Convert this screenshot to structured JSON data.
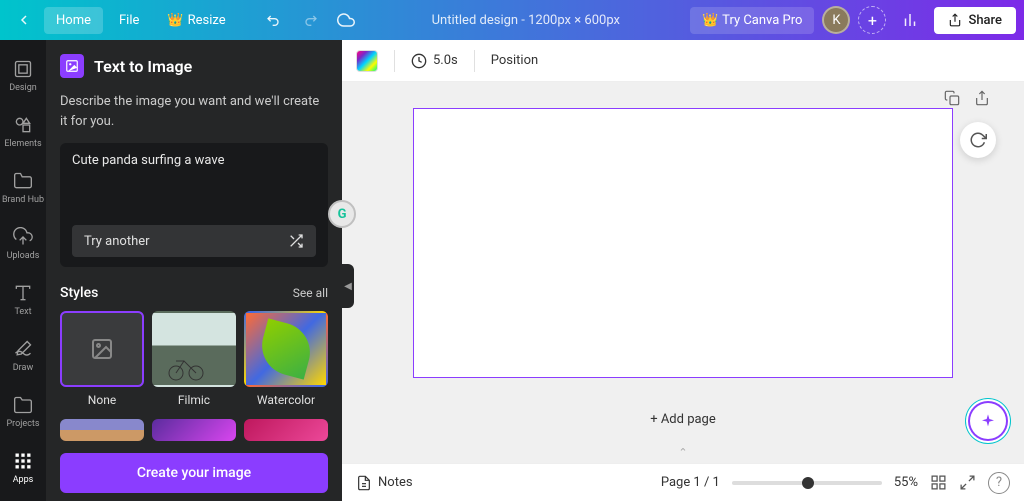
{
  "topbar": {
    "home": "Home",
    "file": "File",
    "resize": "Resize",
    "doc_title": "Untitled design - 1200px × 600px",
    "try_pro": "Try Canva Pro",
    "avatar_initial": "K",
    "share": "Share"
  },
  "rail": {
    "items": [
      {
        "label": "Design"
      },
      {
        "label": "Elements"
      },
      {
        "label": "Brand Hub"
      },
      {
        "label": "Uploads"
      },
      {
        "label": "Text"
      },
      {
        "label": "Draw"
      },
      {
        "label": "Projects"
      },
      {
        "label": "Apps"
      }
    ]
  },
  "panel": {
    "title": "Text to Image",
    "desc": "Describe the image you want and we'll create it for you.",
    "prompt": "Cute panda surfing a wave",
    "try_another": "Try another",
    "styles_label": "Styles",
    "see_all": "See all",
    "styles": [
      {
        "name": "None"
      },
      {
        "name": "Filmic"
      },
      {
        "name": "Watercolor"
      }
    ],
    "create": "Create your image"
  },
  "context": {
    "duration": "5.0s",
    "position": "Position"
  },
  "canvas": {
    "add_page": "+ Add page"
  },
  "footer": {
    "notes": "Notes",
    "page_info": "Page 1 / 1",
    "zoom": "55%"
  }
}
